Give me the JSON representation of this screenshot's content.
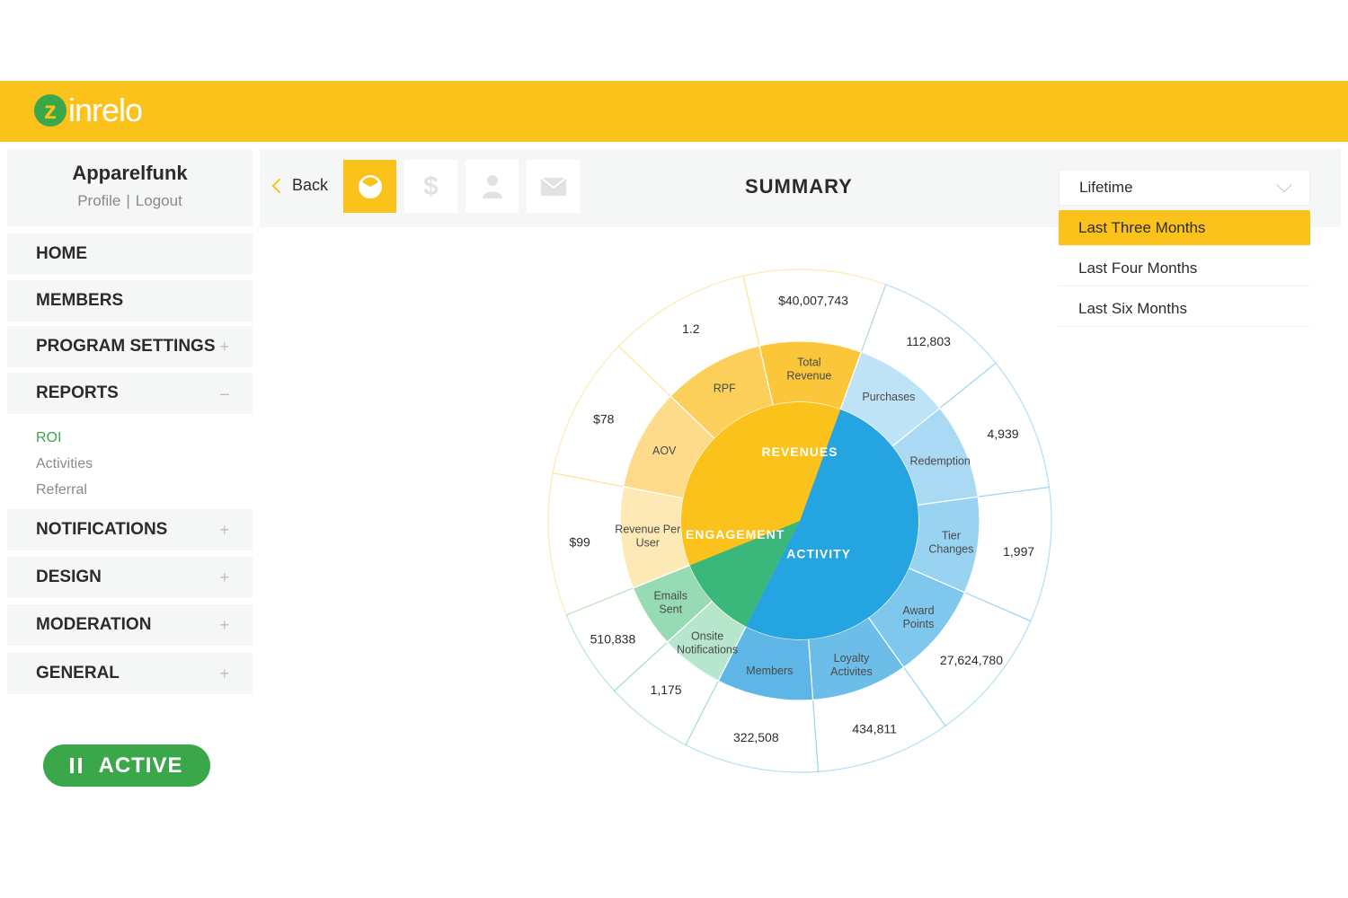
{
  "app": {
    "logo_mark": "z",
    "logo_text": "inrelo"
  },
  "colors": {
    "brand_yellow": "#fbc21b",
    "brand_green": "#3aa84a",
    "activity_blue": "#25a4e2"
  },
  "profile": {
    "name": "Apparelfunk",
    "profile_link": "Profile",
    "separator": "|",
    "logout_link": "Logout"
  },
  "nav": {
    "items": [
      {
        "label": "HOME",
        "sign": ""
      },
      {
        "label": "MEMBERS",
        "sign": ""
      },
      {
        "label": "PROGRAM SETTINGS",
        "sign": "+"
      },
      {
        "label": "REPORTS",
        "sign": "–"
      }
    ],
    "subitems": [
      {
        "label": "ROI"
      },
      {
        "label": "Activities"
      },
      {
        "label": "Referral"
      }
    ],
    "items_after": [
      {
        "label": "NOTIFICATIONS",
        "sign": "+"
      },
      {
        "label": "DESIGN",
        "sign": "+"
      },
      {
        "label": "MODERATION",
        "sign": "+"
      },
      {
        "label": "GENERAL",
        "sign": "+"
      }
    ]
  },
  "status_button": {
    "label": "ACTIVE",
    "icon": "pause-icon"
  },
  "toolbar": {
    "back_label": "Back",
    "title": "SUMMARY",
    "tabs": [
      {
        "icon": "pie-chart-icon",
        "selected": true
      },
      {
        "icon": "dollar-icon",
        "glyph": "$",
        "selected": false
      },
      {
        "icon": "person-icon",
        "selected": false
      },
      {
        "icon": "envelope-icon",
        "selected": false
      }
    ]
  },
  "range": {
    "selected": "Lifetime",
    "options": [
      {
        "label": "Last Three Months",
        "highlighted": true
      },
      {
        "label": "Last Four Months",
        "highlighted": false
      },
      {
        "label": "Last Six Months",
        "highlighted": false
      }
    ]
  },
  "chart_data": {
    "type": "sunburst",
    "groups": [
      {
        "name": "REVENUES",
        "color": "#fbc21b",
        "metrics": [
          {
            "label": "Revenue Per User",
            "value": "$99"
          },
          {
            "label": "AOV",
            "value": "$78"
          },
          {
            "label": "RPF",
            "value": "1.2"
          },
          {
            "label": "Total Revenue",
            "value": "$40,007,743"
          }
        ]
      },
      {
        "name": "ACTIVITY",
        "color": "#25a4e2",
        "metrics": [
          {
            "label": "Purchases",
            "value": "112,803"
          },
          {
            "label": "Redemption",
            "value": "4,939"
          },
          {
            "label": "Tier Changes",
            "value": "1,997"
          },
          {
            "label": "Award Points",
            "value": "27,624,780"
          },
          {
            "label": "Loyalty Activites",
            "value": "434,811"
          },
          {
            "label": "Members",
            "value": "322,508"
          }
        ]
      },
      {
        "name": "ENGAGEMENT",
        "color": "#3ab77a",
        "metrics": [
          {
            "label": "Onsite Notifications",
            "value": "1,175"
          },
          {
            "label": "Emails Sent",
            "value": "510,838"
          }
        ]
      }
    ]
  }
}
